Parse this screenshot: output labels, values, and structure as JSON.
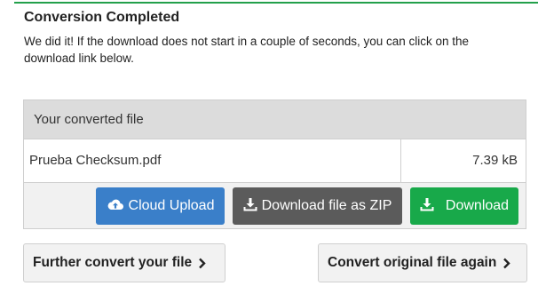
{
  "status": {
    "title": "Conversion Completed",
    "message": "We did it! If the download does not start in a couple of seconds, you can click on the download link below."
  },
  "panel": {
    "header": "Your converted file",
    "file": {
      "name": "Prueba Checksum.pdf",
      "size": "7.39 kB"
    }
  },
  "actions": {
    "cloud_upload": "Cloud Upload",
    "download_zip": "Download file as ZIP",
    "download": "Download",
    "further_convert": "Further convert your file",
    "convert_again": "Convert original file again"
  },
  "icons": {
    "cloud_upload": "cloud-upload-icon",
    "download_zip": "download-icon",
    "download": "download-icon",
    "further_convert": "chevron-right-icon",
    "convert_again": "chevron-right-icon"
  },
  "colors": {
    "accent_line": "#23a04b",
    "cloud_button": "#3a7fc9",
    "zip_button": "#5b5b5b",
    "download_button": "#18a94a"
  }
}
